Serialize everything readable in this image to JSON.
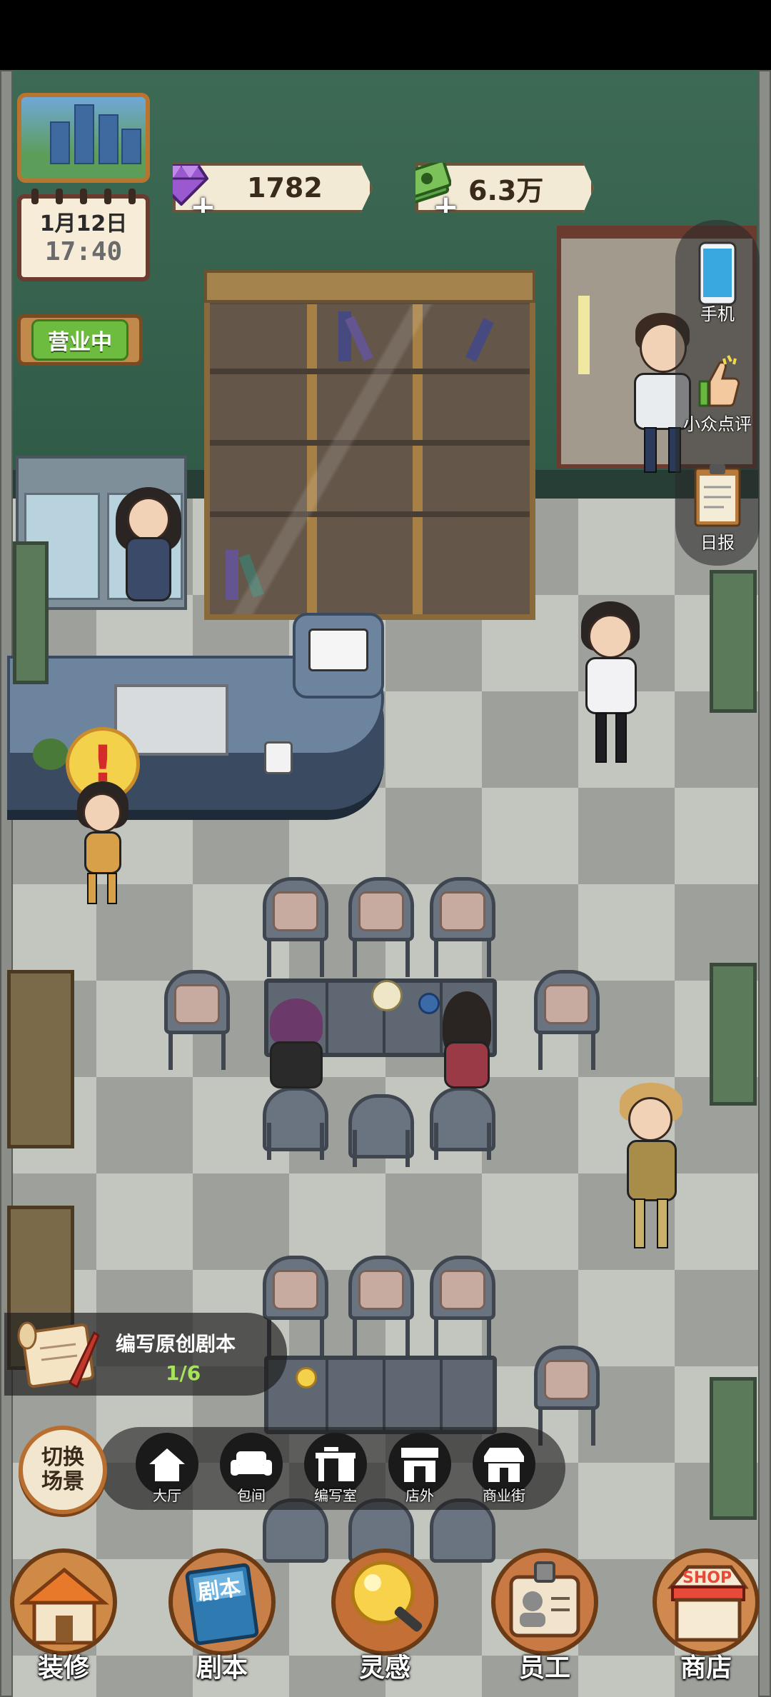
{
  "hud": {
    "gems": "1782",
    "cash": "6.3万",
    "date": "1月12日",
    "time": "17:40",
    "status_sign": "营业中"
  },
  "right_panel": {
    "items": [
      {
        "label": "手机",
        "icon": "phone-icon"
      },
      {
        "label": "小众点评",
        "icon": "thumbs-up-icon"
      },
      {
        "label": "日报",
        "icon": "clipboard-icon"
      }
    ]
  },
  "quest": {
    "title": "编写原创剧本",
    "progress": "1/6"
  },
  "switch_scene": {
    "label": "切换场景"
  },
  "scene_tabs": [
    {
      "label": "大厅",
      "icon": "house-icon"
    },
    {
      "label": "包间",
      "icon": "sofa-icon"
    },
    {
      "label": "编写室",
      "icon": "desk-icon"
    },
    {
      "label": "店外",
      "icon": "storefront-icon"
    },
    {
      "label": "商业街",
      "icon": "street-shop-icon"
    }
  ],
  "nav": [
    {
      "label": "装修",
      "icon": "house-renovate-icon"
    },
    {
      "label": "剧本",
      "icon": "script-book-icon",
      "icon_text": "剧本"
    },
    {
      "label": "灵感",
      "icon": "lightbulb-icon"
    },
    {
      "label": "员工",
      "icon": "staff-badge-icon"
    },
    {
      "label": "商店",
      "icon": "shop-icon",
      "icon_text": "SHOP"
    }
  ],
  "colors": {
    "wall": "#2f5a47",
    "accent_orange": "#b86e2f",
    "open_green": "#6dbb3f",
    "progress_green": "#a7e35b"
  }
}
